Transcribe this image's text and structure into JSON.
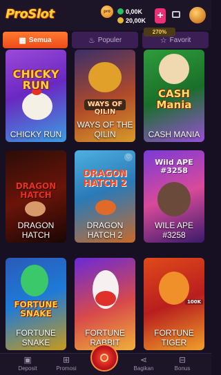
{
  "header": {
    "logo_text": "ProSlot",
    "badge_text": "pro",
    "balance_primary": "0,00K",
    "balance_secondary": "20,00K",
    "add_label": "+",
    "accent_color": "#ee2f76"
  },
  "tabs": [
    {
      "label": "Semua",
      "icon": "grid-icon",
      "active": true
    },
    {
      "label": "Populer",
      "icon": "flame-icon",
      "active": false
    },
    {
      "label": "Favorit",
      "icon": "star-icon",
      "active": false
    }
  ],
  "rtp_badge": "270%",
  "games": [
    {
      "name": "CHICKY RUN",
      "art_title": "CHICKY RUN"
    },
    {
      "name": "WAYS OF THE QILIN",
      "art_title": "WAYS OF QILIN"
    },
    {
      "name": "CASH MANIA",
      "art_title": "CASH Mania"
    },
    {
      "name": "DRAGON HATCH",
      "art_title": "DRAGON HATCH"
    },
    {
      "name": "DRAGON HATCH 2",
      "art_title": "DRAGON HATCH 2"
    },
    {
      "name": "WILE APE #3258",
      "art_title": "Wild APE #3258"
    },
    {
      "name": "FORTUNE SNAKE",
      "art_title": "FORTUNE SNAKE"
    },
    {
      "name": "FORTUNE RABBIT",
      "art_title": ""
    },
    {
      "name": "FORTUNE TIGER",
      "art_title": "100K"
    }
  ],
  "bottom_nav": {
    "deposit": "Deposit",
    "promosi": "Promosi",
    "bagikan": "Bagikan",
    "bonus": "Bonus"
  }
}
